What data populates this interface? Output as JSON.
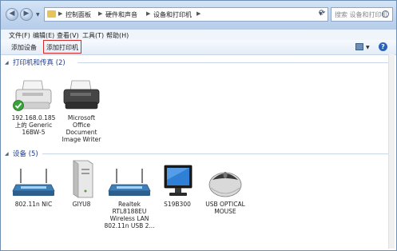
{
  "address": {
    "crumbs": [
      "控制面板",
      "硬件和声音",
      "设备和打印机"
    ],
    "search_placeholder": "搜索 设备和打印机"
  },
  "menu": [
    "文件(F)",
    "编辑(E)",
    "查看(V)",
    "工具(T)",
    "帮助(H)"
  ],
  "commands": {
    "add_device": "添加设备",
    "add_printer": "添加打印机"
  },
  "groups": {
    "printers": {
      "title": "打印机和传真 (2)"
    },
    "devices": {
      "title": "设备 (5)"
    }
  },
  "printers": [
    {
      "lines": [
        "192.168.0.185",
        "上的 Generic",
        "16BW-5"
      ],
      "default": true
    },
    {
      "lines": [
        "Microsoft",
        "Office",
        "Document",
        "Image Writer"
      ],
      "default": false
    }
  ],
  "devices": [
    {
      "lines": [
        "802.11n NIC"
      ],
      "icon": "wifi-router-icon"
    },
    {
      "lines": [
        "GIYU8"
      ],
      "icon": "computer-tower-icon"
    },
    {
      "lines": [
        "Realtek",
        "RTL8188EU",
        "Wireless LAN",
        "802.11n USB 2..."
      ],
      "icon": "wifi-router-icon"
    },
    {
      "lines": [
        "S19B300"
      ],
      "icon": "monitor-icon"
    },
    {
      "lines": [
        "USB OPTICAL",
        "MOUSE"
      ],
      "icon": "mouse-icon"
    }
  ],
  "colors": {
    "highlight": "#d62a2a",
    "group_text": "#1e3a8a"
  }
}
